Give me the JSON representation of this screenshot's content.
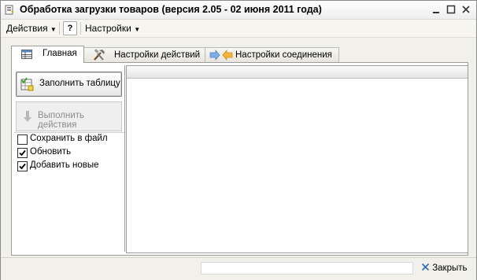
{
  "window": {
    "title": "Обработка загрузки товаров (версия 2.05 - 02 июня 2011 года)"
  },
  "menubar": {
    "actions_label": "Действия",
    "help_label": "?",
    "settings_label": "Настройки"
  },
  "tabs": [
    {
      "label": "Главная",
      "icon": "table-icon",
      "active": true
    },
    {
      "label": "Настройки действий",
      "icon": "tools-icon",
      "active": false
    },
    {
      "label": "Настройки соединения",
      "icon": "arrows-icon",
      "active": false
    }
  ],
  "main": {
    "fill_button_label": "Заполнить таблицу",
    "execute_button_label": "Выполнить действия",
    "options": [
      {
        "label": "Сохранить в файл",
        "checked": false
      },
      {
        "label": "Обновить",
        "checked": true
      },
      {
        "label": "Добавить новые",
        "checked": true
      }
    ]
  },
  "bottombar": {
    "status_value": "",
    "close_label": "Закрыть"
  },
  "colors": {
    "accent": "#3a6fb5",
    "disabled_text": "#8c8c8c",
    "window_bg": "#f1f0ea"
  }
}
